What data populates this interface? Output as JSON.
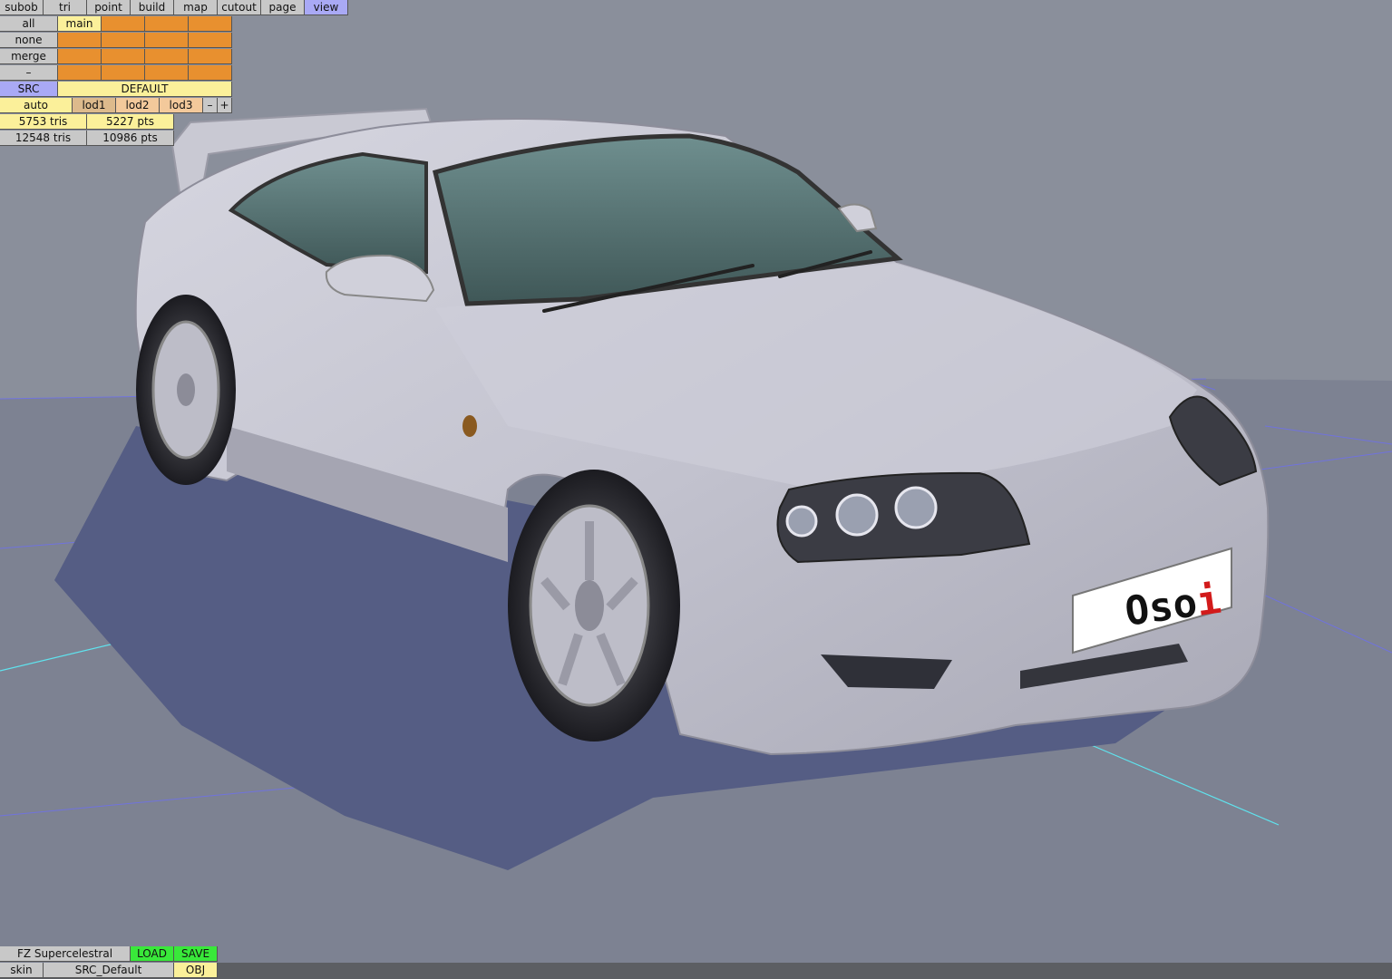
{
  "menu": [
    "subob",
    "tri",
    "point",
    "build",
    "map",
    "cutout",
    "page",
    "view"
  ],
  "menu_active": "view",
  "select_buttons": [
    "all",
    "none",
    "merge",
    "–"
  ],
  "layer_tab": "main",
  "src_label": "SRC",
  "default_label": "DEFAULT",
  "lod": {
    "auto": "auto",
    "levels": [
      "lod1",
      "lod2",
      "lod3"
    ],
    "minus": "–",
    "plus": "+"
  },
  "stats": {
    "lod_tris": "5753 tris",
    "lod_pts": "5227 pts",
    "total_tris": "12548 tris",
    "total_pts": "10986 pts"
  },
  "bottom": {
    "vehicle_name": "FZ Supercelestral",
    "load_label": "LOAD",
    "save_label": "SAVE",
    "skin_label": "skin",
    "skin_value": "SRC_Default",
    "obj_label": "OBJ"
  },
  "plate_text": "Oso",
  "plate_text_accent": "i",
  "colors": {
    "background": "#8a8f9b",
    "body_paint": "#c3c3cf",
    "ground_plane": "#555d84",
    "axis_cyan": "#5fe3ee",
    "grid_blue": "#6d6ff0",
    "accent_red": "#d21a1a"
  }
}
